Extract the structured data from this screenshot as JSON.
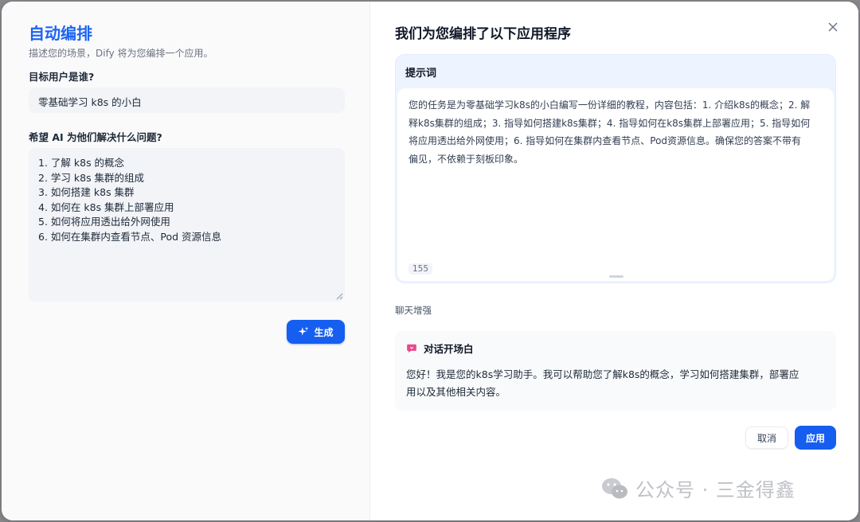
{
  "left": {
    "title": "自动编排",
    "subtitle": "描述您的场景，Dify 将为您编排一个应用。",
    "target_label": "目标用户是谁?",
    "target_value": "零基础学习 k8s 的小白",
    "problem_label": "希望 AI 为他们解决什么问题?",
    "problem_lines": [
      "1. 了解 k8s 的概念",
      "2. 学习 k8s 集群的组成",
      "3. 如何搭建 k8s 集群",
      "4. 如何在 k8s 集群上部署应用",
      "5. 如何将应用透出给外网使用",
      "6. 如何在集群内查看节点、Pod 资源信息"
    ],
    "generate_label": "生成"
  },
  "right": {
    "title": "我们为您编排了以下应用程序",
    "prompt_header": "提示词",
    "prompt_lines": [
      "您的任务是为零基础学习k8s的小白编写一份详细的教程，内容包括：1. 介绍k8s的概念；2. 解",
      "释k8s集群的组成；3. 指导如何搭建k8s集群；4. 指导如何在k8s集群上部署应用；5. 指导如何",
      "将应用透出给外网使用；6. 指导如何在集群内查看节点、Pod资源信息。确保您的答案不带有",
      "偏见，不依赖于刻板印象。"
    ],
    "char_count": "155",
    "section_label": "聊天增强",
    "opener_title": "对话开场白",
    "opener_lines": [
      "您好！我是您的k8s学习助手。我可以帮助您了解k8s的概念，学习如何搭建集群，部署应",
      "用以及其他相关内容。"
    ],
    "cancel_label": "取消",
    "apply_label": "应用"
  },
  "watermark": {
    "text": "公众号 · 三金得鑫"
  },
  "colors": {
    "accent": "#155eef",
    "title_blue": "#1c64f2",
    "prompt_bg": "#eef4ff",
    "opener_icon": "#e8488c"
  },
  "icons": {
    "close": "close-icon",
    "generate": "sparkle-icon",
    "opener": "chat-bubble-icon",
    "watermark": "wechat-icon"
  }
}
